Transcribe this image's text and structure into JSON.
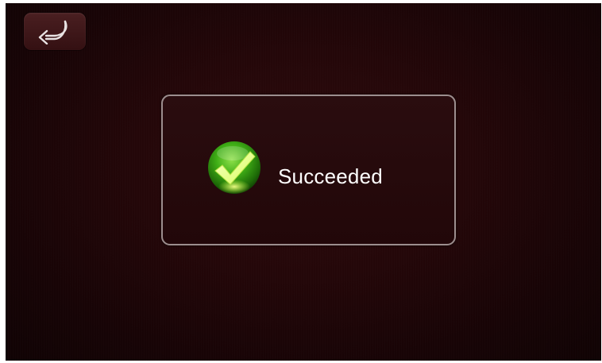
{
  "back_button": {
    "icon": "return-arrow-icon"
  },
  "dialog": {
    "icon": "checkmark-success-icon",
    "message": "Succeeded"
  },
  "colors": {
    "background": "#1b0507",
    "dialog_border": "#9c8e8e",
    "success_green": "#3fae16",
    "check_yellow": "#e8ff7a",
    "text": "#ffffff"
  }
}
